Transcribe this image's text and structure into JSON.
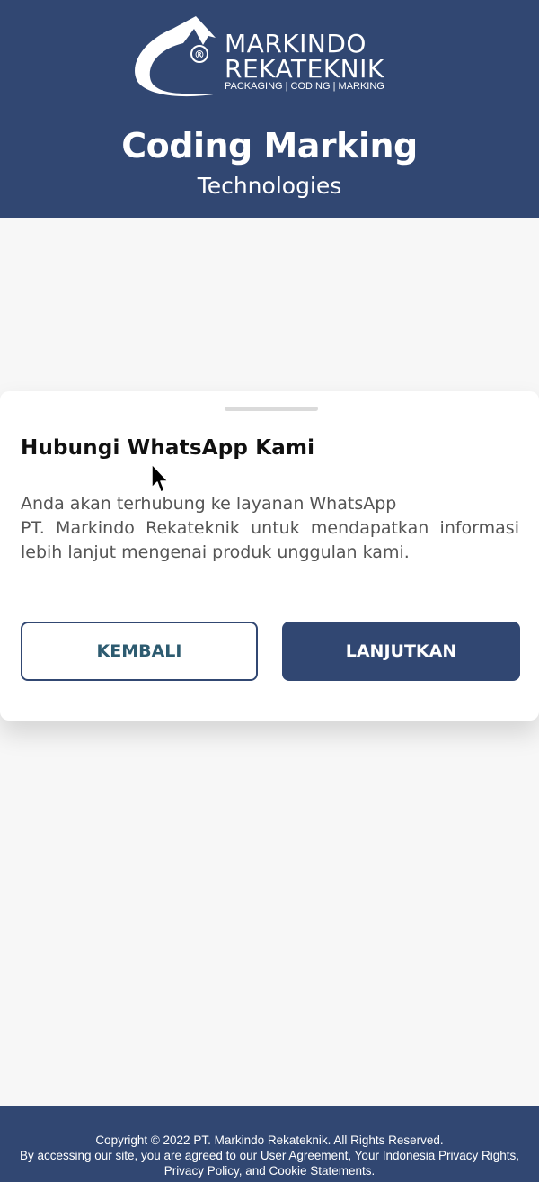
{
  "header": {
    "logo": {
      "line1": "MARKINDO",
      "line2": "REKATEKNIK",
      "tagline": "PACKAGING | CODING | MARKING",
      "registered_mark": "®"
    },
    "title": "Coding Marking",
    "subtitle": "Technologies"
  },
  "dialog": {
    "title": "Hubungi WhatsApp Kami",
    "body_line1": "Anda akan terhubung ke layanan WhatsApp",
    "body_rest": "PT. Markindo Rekateknik untuk mendapatkan informasi lebih lanjut mengenai produk unggulan kami.",
    "back_label": "KEMBALI",
    "continue_label": "LANJUTKAN"
  },
  "footer": {
    "copyright": "Copyright © 2022 PT. Markindo Rekateknik. All Rights Reserved.",
    "agreement": "By accessing our site, you are agreed to our User Agreement, Your Indonesia Privacy Rights, Privacy Policy, and Cookie Statements."
  },
  "colors": {
    "brand_primary": "#314772",
    "button_outline_text": "#2d5b70",
    "page_background": "#f7f7f7"
  }
}
